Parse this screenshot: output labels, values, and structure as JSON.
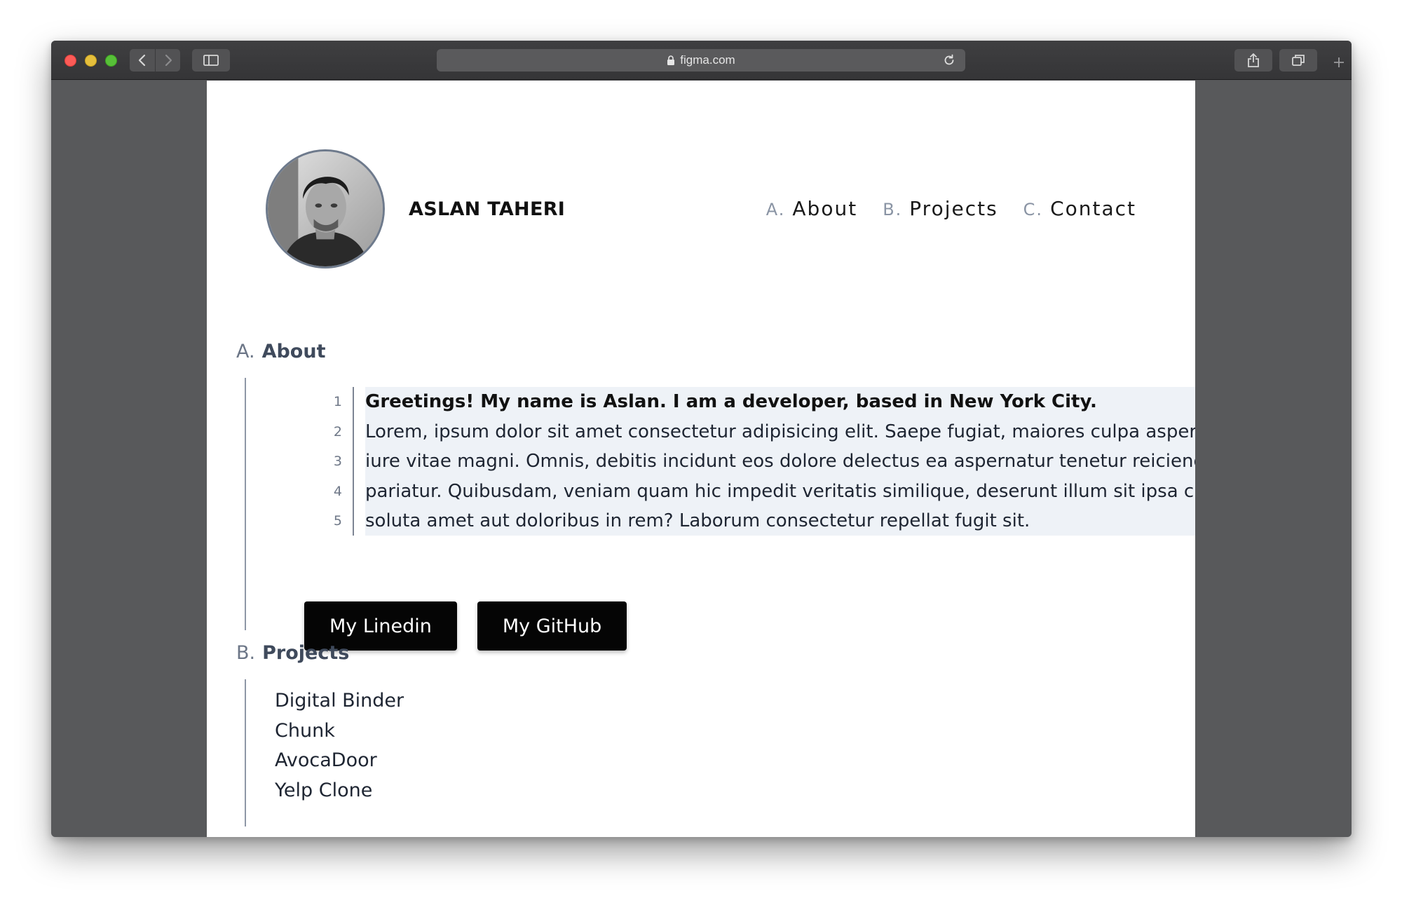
{
  "browser": {
    "url": "figma.com",
    "icons": {
      "back": "chevron-left-icon",
      "forward": "chevron-right-icon",
      "sidebar": "sidebar-icon",
      "lock": "lock-icon",
      "reload": "reload-icon",
      "share": "share-icon",
      "tabs": "tabs-icon",
      "new_tab": "plus-icon"
    }
  },
  "header": {
    "name": "ASLAN TAHERI",
    "avatar_icon": "profile-photo",
    "nav": [
      {
        "letter": "A.",
        "label": "About"
      },
      {
        "letter": "B.",
        "label": "Projects"
      },
      {
        "letter": "C.",
        "label": "Contact"
      }
    ]
  },
  "about": {
    "letter": "A.",
    "title": "About",
    "lines": [
      {
        "num": "1",
        "text": "Greetings! My name is Aslan. I am a developer, based in New York City."
      },
      {
        "num": "2",
        "text": "Lorem, ipsum dolor sit amet consectetur adipisicing elit. Saepe fugiat, maiores culpa asperiores"
      },
      {
        "num": "3",
        "text": "iure vitae magni. Omnis, debitis incidunt eos dolore delectus ea aspernatur tenetur reiciendis"
      },
      {
        "num": "4",
        "text": "pariatur. Quibusdam, veniam quam hic impedit veritatis similique, deserunt illum sit ipsa cumque,"
      },
      {
        "num": "5",
        "text": "soluta amet aut doloribus in rem? Laborum consectetur repellat fugit sit."
      }
    ],
    "buttons": {
      "linkedin": "My Linedin",
      "github": "My GitHub"
    }
  },
  "projects": {
    "letter": "B.",
    "title": "Projects",
    "items": [
      "Digital Binder",
      "Chunk",
      "AvocaDoor",
      "Yelp Clone"
    ]
  },
  "colors": {
    "window_chrome": "#3a3a3c",
    "page_backdrop": "#58595b",
    "code_highlight": "#eef2f7",
    "button_bg": "#050505",
    "accent_muted": "#8a94a4"
  }
}
